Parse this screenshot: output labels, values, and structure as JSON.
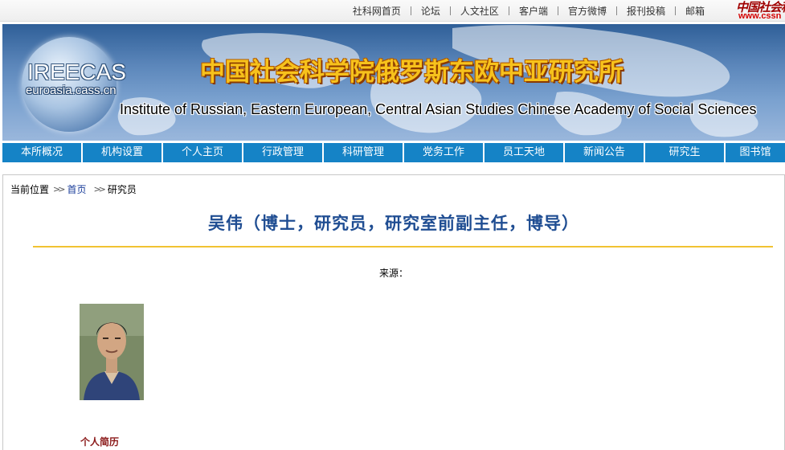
{
  "top_links": [
    "社科网首页",
    "论坛",
    "人文社区",
    "客户端",
    "官方微博",
    "报刊投稿",
    "邮箱"
  ],
  "cssn_logo": {
    "cn": "中国社会科",
    "en": "www.cssn"
  },
  "banner": {
    "logo_title": "IREECAS",
    "logo_url": "euroasia.cass.cn",
    "cn_title": "中国社会科学院俄罗斯东欧中亚研究所",
    "en_title": "Institute of Russian, Eastern European, Central Asian Studies Chinese Academy of Social Sciences"
  },
  "nav": [
    "本所概况",
    "机构设置",
    "个人主页",
    "行政管理",
    "科研管理",
    "党务工作",
    "员工天地",
    "新闻公告",
    "研究生",
    "图书馆"
  ],
  "breadcrumb": {
    "label": "当前位置",
    "arrow": ">>",
    "home": "首页",
    "current": "研究员"
  },
  "article": {
    "title": "吴伟（博士，研究员，研究室前副主任，博导）",
    "source": "来源：",
    "bio_heading": "个人简历"
  },
  "colors": {
    "nav_bg": "#1583c6",
    "title_color": "#1f4d92",
    "rule_color": "#f1c232",
    "bio_heading_color": "#8b1a1a",
    "banner_title_color": "#f7c21c"
  }
}
